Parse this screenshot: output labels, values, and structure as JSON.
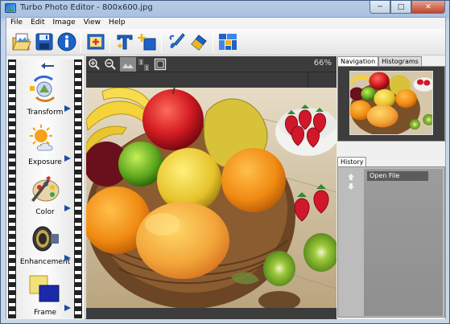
{
  "window": {
    "title": "Turbo Photo Editor - 800x600.jpg",
    "controls": [
      "─",
      "□",
      "✕"
    ]
  },
  "menu": [
    "File",
    "Edit",
    "Image",
    "View",
    "Help"
  ],
  "toolbar": {
    "buttons": [
      "open-icon",
      "save-icon",
      "info-icon",
      "photo-resize-icon",
      "add-text-icon",
      "add-watermark-icon",
      "brush-icon",
      "eraser-icon",
      "collage-icon"
    ]
  },
  "left_panel": {
    "tools": [
      {
        "label": "Transform",
        "icon": "transform-icon"
      },
      {
        "label": "Exposure",
        "icon": "exposure-icon"
      },
      {
        "label": "Color",
        "icon": "color-palette-icon"
      },
      {
        "label": "Enhancement",
        "icon": "lens-icon"
      },
      {
        "label": "Frame",
        "icon": "frame-icon"
      }
    ]
  },
  "viewer": {
    "zoom": "66%"
  },
  "right_panel": {
    "tabs": [
      "Navigation",
      "Histograms"
    ],
    "active_tab": "Navigation",
    "history_tab": "History",
    "history_items": [
      "Open File"
    ]
  }
}
